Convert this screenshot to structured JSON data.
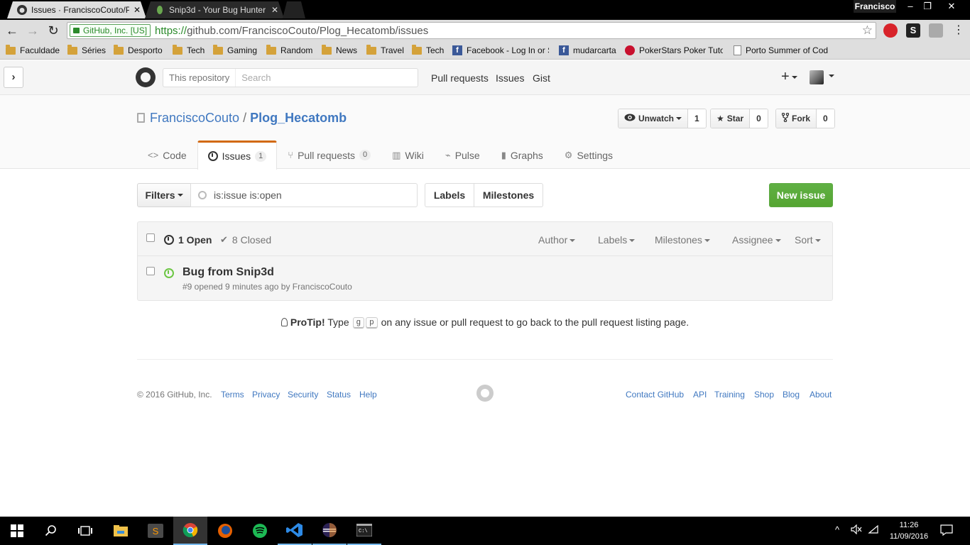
{
  "browser": {
    "tabs": [
      {
        "title": "Issues · FranciscoCouto/Plog_Hecatomb",
        "active": true,
        "icon": "github-octocat-icon"
      },
      {
        "title": "Snip3d - Your Bug Hunter",
        "active": false,
        "icon": "snip3d-icon"
      }
    ],
    "user": "Francisco",
    "window_controls": {
      "minimize": "–",
      "restore": "❐",
      "close": "✕"
    },
    "ev_badge": "GitHub, Inc. [US]",
    "url_scheme": "https://",
    "url_rest": "github.com/FranciscoCouto/Plog_Hecatomb/issues",
    "bookmarks": [
      {
        "label": "Faculdade",
        "icon": "folder-icon"
      },
      {
        "label": "Séries",
        "icon": "folder-icon"
      },
      {
        "label": "Desporto",
        "icon": "folder-icon"
      },
      {
        "label": "Tech",
        "icon": "folder-icon"
      },
      {
        "label": "Gaming",
        "icon": "folder-icon"
      },
      {
        "label": "Random",
        "icon": "folder-icon"
      },
      {
        "label": "News",
        "icon": "folder-icon"
      },
      {
        "label": "Travel",
        "icon": "folder-icon"
      },
      {
        "label": "Tech",
        "icon": "folder-icon"
      },
      {
        "label": "Facebook - Log In or S",
        "icon": "facebook-icon"
      },
      {
        "label": "mudarcarta",
        "icon": "facebook-icon"
      },
      {
        "label": "PokerStars Poker Tuto",
        "icon": "pokerstars-icon"
      },
      {
        "label": "Porto Summer of Cod",
        "icon": "page-icon"
      }
    ]
  },
  "gh_header": {
    "search_scope": "This repository",
    "search_placeholder": "Search",
    "nav": [
      "Pull requests",
      "Issues",
      "Gist"
    ]
  },
  "repo": {
    "owner": "FranciscoCouto",
    "separator": "/",
    "name": "Plog_Hecatomb",
    "watch_label": "Unwatch",
    "watch_count": "1",
    "star_label": "Star",
    "star_count": "0",
    "fork_label": "Fork",
    "fork_count": "0",
    "tabs": [
      {
        "label": "Code",
        "icon": "code-icon",
        "counter": null
      },
      {
        "label": "Issues",
        "icon": "issue-opened-icon",
        "counter": "1"
      },
      {
        "label": "Pull requests",
        "icon": "pull-request-icon",
        "counter": "0"
      },
      {
        "label": "Wiki",
        "icon": "book-icon",
        "counter": null
      },
      {
        "label": "Pulse",
        "icon": "pulse-icon",
        "counter": null
      },
      {
        "label": "Graphs",
        "icon": "graph-icon",
        "counter": null
      },
      {
        "label": "Settings",
        "icon": "gear-icon",
        "counter": null
      }
    ]
  },
  "issues": {
    "filters_label": "Filters",
    "query": "is:issue is:open",
    "labels_label": "Labels",
    "milestones_label": "Milestones",
    "new_issue_label": "New issue",
    "open_label": "1 Open",
    "closed_label": "8 Closed",
    "header_filters": [
      "Author",
      "Labels",
      "Milestones",
      "Assignee",
      "Sort"
    ],
    "items": [
      {
        "title": "Bug from Snip3d",
        "meta": "#9 opened 9 minutes ago by FranciscoCouto"
      }
    ]
  },
  "protip": {
    "lead": "ProTip!",
    "pre": "Type",
    "key1": "g",
    "key2": "p",
    "post": "on any issue or pull request to go back to the pull request listing page."
  },
  "footer": {
    "copyright": "© 2016 GitHub, Inc.",
    "left_links": [
      "Terms",
      "Privacy",
      "Security",
      "Status",
      "Help"
    ],
    "right_links": [
      "Contact GitHub",
      "API",
      "Training",
      "Shop",
      "Blog",
      "About"
    ]
  },
  "taskbar": {
    "time": "11:26",
    "date": "11/09/2016"
  },
  "colors": {
    "link": "#4078c0",
    "new_issue_green": "#55a532",
    "open_icon_green": "#6cc644",
    "selected_tab_accent": "#d26911"
  }
}
